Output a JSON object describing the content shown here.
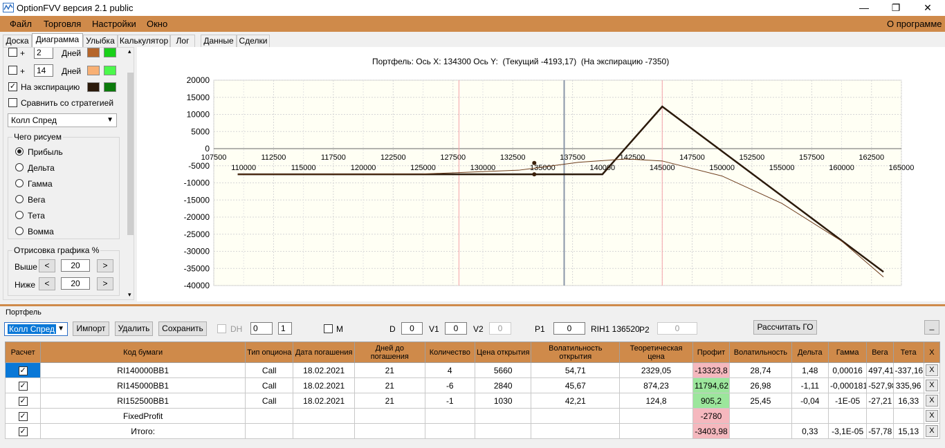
{
  "window": {
    "title": "OptionFVV версия 2.1 public",
    "minimize": "—",
    "maximize": "❐",
    "close": "✕"
  },
  "menu": {
    "file": "Файл",
    "trade": "Торговля",
    "settings": "Настройки",
    "window": "Окно",
    "about": "О программе"
  },
  "tabs": [
    "Доска",
    "Диаграмма",
    "Улыбка",
    "Калькулятор",
    "Лог",
    "Данные",
    "Сделки"
  ],
  "left": {
    "row1": {
      "plus": "+",
      "days": "2",
      "days_label": "Дней",
      "color1": "#b5652a",
      "color2": "#19d019"
    },
    "row2": {
      "plus": "+",
      "days": "14",
      "days_label": "Дней",
      "color1": "#f8b074",
      "color2": "#4cf84c"
    },
    "row3": {
      "label": "На экспирацию",
      "color1": "#2b1a0b",
      "color2": "#0b7a0b",
      "checkmark": "✓"
    },
    "compare_label": "Сравнить со стратегией",
    "strategy": "Колл Спред",
    "draw_group": "Чего рисуем",
    "radios": [
      "Прибыль",
      "Дельта",
      "Гамма",
      "Вега",
      "Тета",
      "Вомма"
    ],
    "render_group": "Отрисовка графика %",
    "above_label": "Выше",
    "above_value": "20",
    "below_label": "Ниже",
    "below_value": "20",
    "lt": "<",
    "gt": ">",
    "scroll_up": "▴",
    "scroll_down": "▾"
  },
  "chart": {
    "title": "Портфель: Ось X: 134300 Ось Y:  (Текущий -4193,17)  (На экспирацию -7350)",
    "y_ticks": [
      "20000",
      "15000",
      "10000",
      "5000",
      "0",
      "-5000",
      "-10000",
      "-15000",
      "-20000",
      "-25000",
      "-30000",
      "-35000",
      "-40000"
    ],
    "x_ticks_top": [
      "107500",
      "112500",
      "117500",
      "122500",
      "127500",
      "132500",
      "137500",
      "142500",
      "147500",
      "152500",
      "157500",
      "162500"
    ],
    "x_ticks_bottom": [
      "110000",
      "115000",
      "120000",
      "125000",
      "130000",
      "135000",
      "140000",
      "145000",
      "150000",
      "155000",
      "160000",
      "165000"
    ]
  },
  "chart_data": {
    "type": "line",
    "ylim": [
      -40000,
      20000
    ],
    "xlim": [
      107500,
      165000
    ],
    "series": [
      {
        "x": [
          109500,
          140000,
          145000,
          163500
        ],
        "y": [
          -7500,
          -7500,
          12300,
          -36000
        ],
        "color": "#2b1a0b"
      },
      {
        "x": [
          109500,
          125000,
          133000,
          138000,
          142000,
          145000,
          150000,
          155000,
          160000,
          163500
        ],
        "y": [
          -7500,
          -7400,
          -6300,
          -4000,
          -3000,
          -3600,
          -8000,
          -16000,
          -27000,
          -37500
        ],
        "color": "#6b3a1a"
      }
    ],
    "vlines": [
      {
        "x": 128000,
        "color": "#f4a0a8"
      },
      {
        "x": 136800,
        "color": "#8a96a8"
      },
      {
        "x": 145000,
        "color": "#f4a0a8"
      }
    ],
    "markers": [
      {
        "x": 134300,
        "y": -4193.17
      },
      {
        "x": 134300,
        "y": -7500
      }
    ]
  },
  "portfolio": {
    "label": "Портфель",
    "strategy": "Колл Спред",
    "import": "Импорт",
    "delete": "Удалить",
    "save": "Сохранить",
    "dh": "DH",
    "spin1": "0",
    "spin2": "1",
    "m": "M",
    "d_label": "D",
    "d_val": "0",
    "v1_label": "V1",
    "v1_val": "0",
    "v2_label": "V2",
    "v2_val": "0",
    "p1_label": "P1",
    "p1_val": "0",
    "instrument": "RIH1 136520",
    "p2_label": "P2",
    "p2_val": "0",
    "calc": "Рассчитать ГО",
    "minimize": "_"
  },
  "table": {
    "headers": [
      "Расчет",
      "Код бумаги",
      "Тип опциона",
      "Дата погашения",
      "Дней до погашения",
      "Количество",
      "Цена открытия",
      "Волатильность открытия",
      "Теоретическая цена",
      "Профит",
      "Волатильность",
      "Дельта",
      "Гамма",
      "Вега",
      "Тета",
      "X"
    ],
    "rows": [
      [
        "✓",
        "RI140000BB1",
        "Call",
        "18.02.2021",
        "21",
        "4",
        "5660",
        "54,71",
        "2329,05",
        "-13323,8",
        "28,74",
        "1,48",
        "0,00016",
        "497,41",
        "-337,16",
        "X"
      ],
      [
        "✓",
        "RI145000BB1",
        "Call",
        "18.02.2021",
        "21",
        "-6",
        "2840",
        "45,67",
        "874,23",
        "11794,62",
        "26,98",
        "-1,11",
        "-0,000181",
        "-527,98",
        "335,96",
        "X"
      ],
      [
        "✓",
        "RI152500BB1",
        "Call",
        "18.02.2021",
        "21",
        "-1",
        "1030",
        "42,21",
        "124,8",
        "905,2",
        "25,45",
        "-0,04",
        "-1E-05",
        "-27,21",
        "16,33",
        "X"
      ],
      [
        "✓",
        "FixedProfit",
        "",
        "",
        "",
        "",
        "",
        "",
        "",
        "-2780",
        "",
        "",
        "",
        "",
        "",
        "X"
      ],
      [
        "✓",
        "Итого:",
        "",
        "",
        "",
        "",
        "",
        "",
        "",
        "-3403,98",
        "",
        "0,33",
        "-3,1E-05",
        "-57,78",
        "15,13",
        "X"
      ]
    ]
  }
}
